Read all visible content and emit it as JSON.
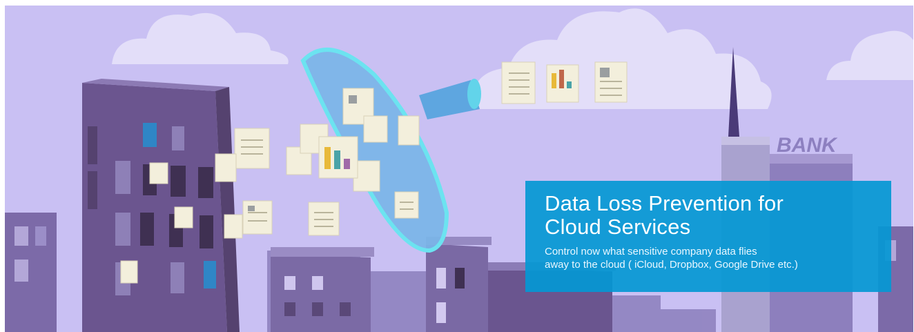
{
  "banner": {
    "title_lines": [
      "Data Loss Prevention for",
      "Cloud Services"
    ],
    "subtitle_lines": [
      "Control now what sensitive company data flies",
      "away to the cloud ( iCloud, Dropbox, Google Drive etc.)"
    ],
    "sign_text": "BANK"
  },
  "colors": {
    "sky": "#c9c0f3",
    "cloud": "#e4dffa",
    "building_dark": "#6a548f",
    "building_light": "#7c6fa6",
    "funnel": "#6fb1e6",
    "funnel_rim": "#7fe2ef",
    "promo_box": "#0498d4",
    "document": "#f2eedb"
  },
  "icons": [
    "cloud-icon",
    "funnel-icon",
    "document-icon",
    "bar-chart-document-icon",
    "bank-building-icon"
  ]
}
